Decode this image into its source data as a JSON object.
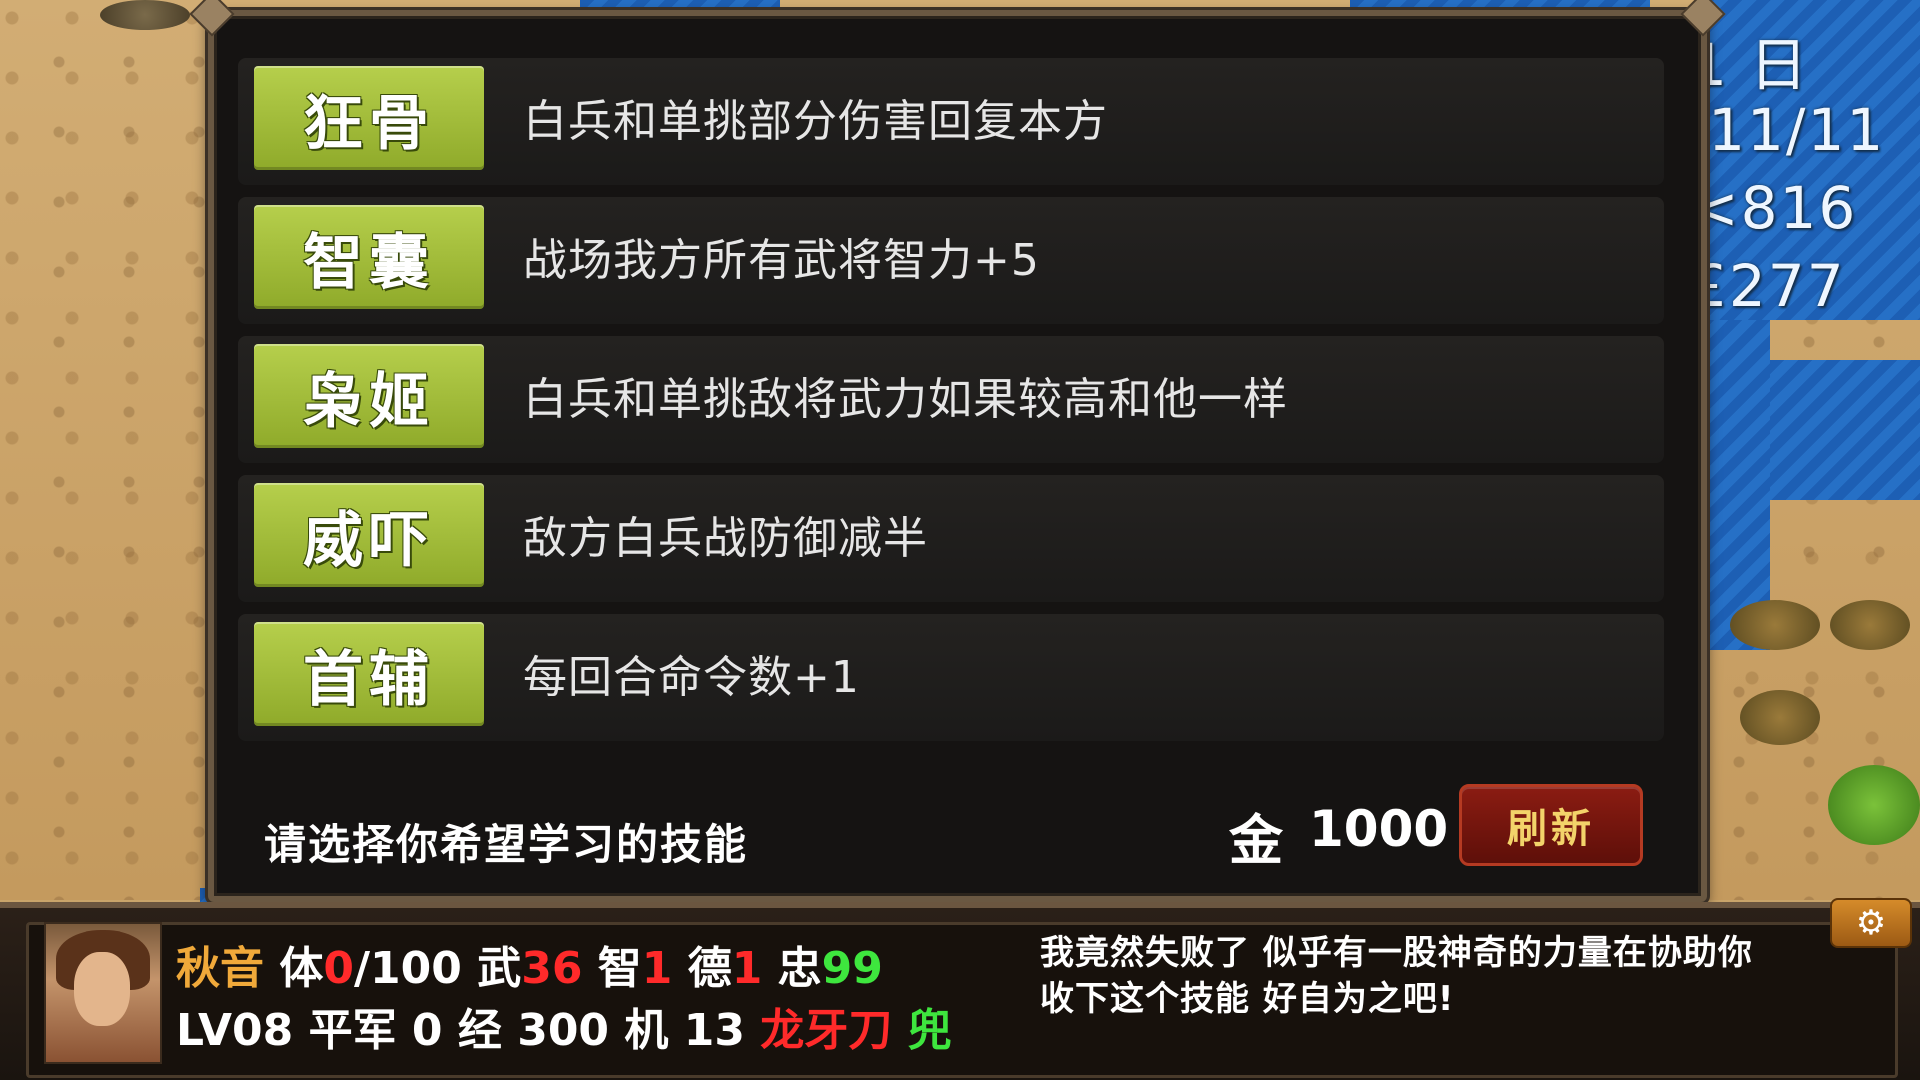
{
  "side_hud": {
    "line1": "1 日",
    "line2": "l11/11",
    "line3": "<816",
    "line4": "£277"
  },
  "skills": [
    {
      "name": "狂骨",
      "desc": "白兵和单挑部分伤害回复本方"
    },
    {
      "name": "智囊",
      "desc": "战场我方所有武将智力+5"
    },
    {
      "name": "枭姬",
      "desc": "白兵和单挑敌将武力如果较高和他一样"
    },
    {
      "name": "威吓",
      "desc": "敌方白兵战防御减半"
    },
    {
      "name": "首辅",
      "desc": "每回合命令数+1"
    }
  ],
  "prompt": "请选择你希望学习的技能",
  "gold": {
    "label": "金",
    "value": "1000"
  },
  "refresh_label": "刷新",
  "character": {
    "name": "秋音",
    "hp_label": "体",
    "hp_current": "0",
    "hp_max": "/100",
    "str_label": "武",
    "str_value": "36",
    "int_label": "智",
    "int_value": "1",
    "virtue_label": "德",
    "virtue_value": "1",
    "loyal_label": "忠",
    "loyal_value": "99",
    "level": "LV08",
    "class": "平军",
    "zero": "0",
    "exp_label": "经",
    "exp_value": "300",
    "mob_label": "机",
    "mob_value": "13",
    "weapon": "龙牙刀",
    "armor": "兜"
  },
  "message": {
    "line1": "我竟然失败了 似乎有一股神奇的力量在协助你",
    "line2": "收下这个技能 好自为之吧!"
  },
  "gear_icon": "gear-icon"
}
